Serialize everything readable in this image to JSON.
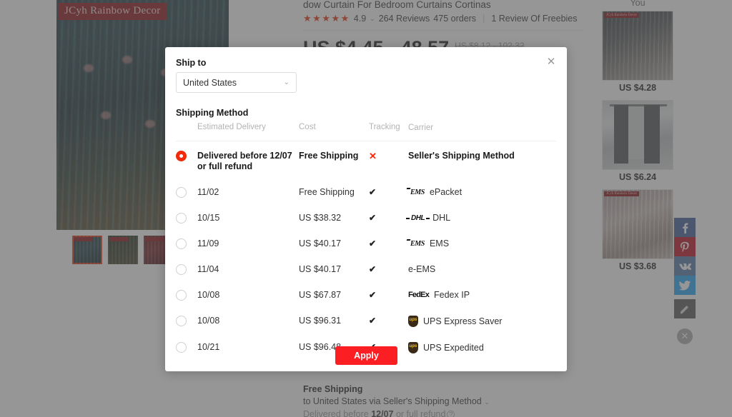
{
  "background": {
    "gallery": {
      "watermark": "JCyh Rainbow Decor",
      "thumbnails": [
        {
          "name": "thumb-1-selected"
        },
        {
          "name": "thumb-2"
        },
        {
          "name": "thumb-3"
        }
      ]
    },
    "product": {
      "title": "dow Curtain For Bedroom Curtains Cortinas",
      "stars": "★★★★★",
      "rating": "4.9",
      "reviews": "264 Reviews",
      "orders": "475 orders",
      "freebies": "1 Review Of Freebies",
      "price": "US $4.45 - 48.57",
      "price_old": "US $8.12 - 102.32"
    },
    "shipping_summary": {
      "title": "Free Shipping",
      "line2": "to United States via Seller's Shipping Method",
      "line3_prefix": "Delivered before ",
      "line3_date": "12/07",
      "line3_suffix": " or full refund"
    },
    "rail": {
      "title": "You",
      "items": [
        {
          "watermark": "JCyh Rainbow Decor",
          "price": "US $4.28"
        },
        {
          "watermark": "",
          "price": "US $6.24"
        },
        {
          "watermark": "JCyh Rainbow Decor",
          "price": "US $3.68"
        }
      ]
    },
    "social": [
      {
        "name": "facebook-share-button",
        "color": "#3b5998"
      },
      {
        "name": "pinterest-share-button",
        "color": "#bd081c"
      },
      {
        "name": "vk-share-button",
        "color": "#4c75a3"
      },
      {
        "name": "twitter-share-button",
        "color": "#1da1f2"
      },
      {
        "name": "edit-share-button",
        "color": "#555555"
      }
    ]
  },
  "modal": {
    "close_icon": "✕",
    "ship_to_label": "Ship to",
    "country": {
      "value": "United States",
      "caret": "⌄"
    },
    "shipping_method_label": "Shipping Method",
    "columns": {
      "estimated_delivery": "Estimated Delivery",
      "cost": "Cost",
      "tracking": "Tracking",
      "carrier": "Carrier"
    },
    "rows": [
      {
        "selected": true,
        "eta": "Delivered before 12/07 or full refund",
        "cost": "Free Shipping",
        "tracking": "x",
        "tracking_glyph": "✕",
        "carrier_logo": "none",
        "carrier": "Seller's Shipping Method"
      },
      {
        "selected": false,
        "eta": "11/02",
        "cost": "Free Shipping",
        "tracking": "check",
        "tracking_glyph": "✔",
        "carrier_logo": "ems",
        "carrier_logo_text": "EMS",
        "carrier": "ePacket"
      },
      {
        "selected": false,
        "eta": "10/15",
        "cost": "US $38.32",
        "tracking": "check",
        "tracking_glyph": "✔",
        "carrier_logo": "dhl",
        "carrier_logo_text": "DHL",
        "carrier": "DHL"
      },
      {
        "selected": false,
        "eta": "11/09",
        "cost": "US $40.17",
        "tracking": "check",
        "tracking_glyph": "✔",
        "carrier_logo": "ems",
        "carrier_logo_text": "EMS",
        "carrier": "EMS"
      },
      {
        "selected": false,
        "eta": "11/04",
        "cost": "US $40.17",
        "tracking": "check",
        "tracking_glyph": "✔",
        "carrier_logo": "none",
        "carrier": "e-EMS"
      },
      {
        "selected": false,
        "eta": "10/08",
        "cost": "US $67.87",
        "tracking": "check",
        "tracking_glyph": "✔",
        "carrier_logo": "fedex",
        "carrier_logo_text": "FedEx",
        "carrier": "Fedex IP"
      },
      {
        "selected": false,
        "eta": "10/08",
        "cost": "US $96.31",
        "tracking": "check",
        "tracking_glyph": "✔",
        "carrier_logo": "ups",
        "carrier_logo_text": "ups",
        "carrier": "UPS Express Saver"
      },
      {
        "selected": false,
        "eta": "10/21",
        "cost": "US $96.48",
        "tracking": "check",
        "tracking_glyph": "✔",
        "carrier_logo": "ups",
        "carrier_logo_text": "ups",
        "carrier": "UPS Expedited"
      }
    ],
    "apply_label": "Apply"
  },
  "colors": {
    "accent_red": "#fb1f24",
    "star_red": "#e62e04",
    "overlay": "#555555"
  }
}
